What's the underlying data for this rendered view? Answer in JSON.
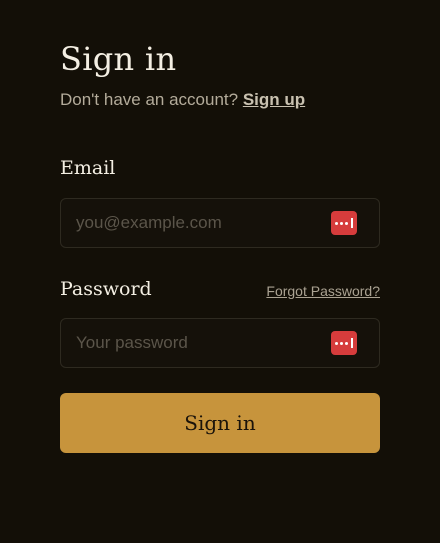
{
  "header": {
    "title": "Sign in",
    "subtitle_text": "Don't have an account? ",
    "signup_link": "Sign up"
  },
  "form": {
    "email": {
      "label": "Email",
      "placeholder": "you@example.com",
      "value": "",
      "addon_icon": "password-manager-icon"
    },
    "password": {
      "label": "Password",
      "forgot_link": "Forgot Password?",
      "placeholder": "Your password",
      "value": "",
      "addon_icon": "password-manager-icon"
    },
    "submit_label": "Sign in"
  },
  "colors": {
    "background": "#130f07",
    "accent": "#c7943c",
    "password_manager": "#d63c3c",
    "field_border": "#2e2a20"
  }
}
